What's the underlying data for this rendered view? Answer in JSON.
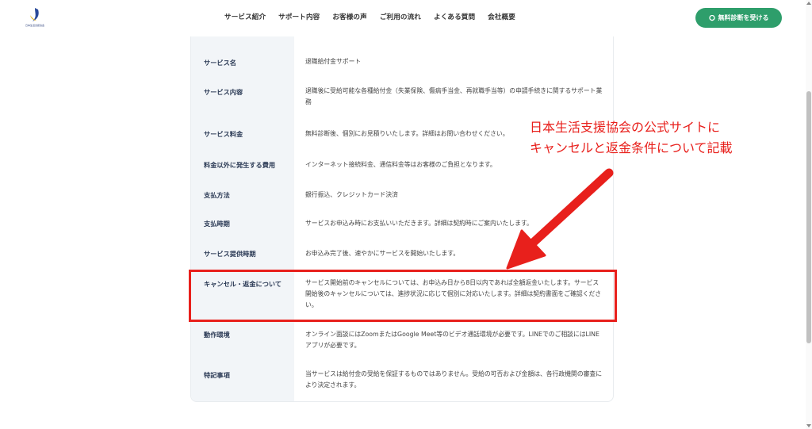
{
  "header": {
    "logo_text": "日本生活支援協会",
    "nav": [
      "サービス紹介",
      "サポート内容",
      "お客様の声",
      "ご利用の流れ",
      "よくある質問",
      "会社概要"
    ],
    "cta_label": "無料診断を受ける"
  },
  "table": {
    "rows": [
      {
        "label": "サービス名",
        "value": "退職給付金サポート"
      },
      {
        "label": "サービス内容",
        "value": "退職後に受給可能な各種給付金（失業保険、傷病手当金、再就職手当等）の申請手続きに関するサポート業務"
      },
      {
        "label": "サービス料金",
        "value": "無料診断後、個別にお見積りいたします。詳細はお問い合わせください。"
      },
      {
        "label": "料金以外に発生する費用",
        "value": "インターネット接続料金、通信料金等はお客様のご負担となります。"
      },
      {
        "label": "支払方法",
        "value": "銀行振込、クレジットカード決済"
      },
      {
        "label": "支払時期",
        "value": "サービスお申込み時にお支払いいただきます。詳細は契約時にご案内いたします。"
      },
      {
        "label": "サービス提供時期",
        "value": "お申込み完了後、速やかにサービスを開始いたします。"
      },
      {
        "label": "キャンセル・返金について",
        "value": "サービス開始前のキャンセルについては、お申込み日から8日以内であれば全額返金いたします。サービス開始後のキャンセルについては、進捗状況に応じて個別に対応いたします。詳細は契約書面をご確認ください。"
      },
      {
        "label": "動作環境",
        "value": "オンライン面談にはZoomまたはGoogle Meet等のビデオ通話環境が必要です。LINEでのご相談にはLINEアプリが必要です。"
      },
      {
        "label": "特記事項",
        "value": "当サービスは給付金の受給を保証するものではありません。受給の可否および金額は、各行政機関の審査により決定されます。"
      }
    ]
  },
  "annotation": {
    "line1": "日本生活支援協会の公式サイトに",
    "line2": "キャンセルと返金条件について記載",
    "color": "#e8201c"
  },
  "colors": {
    "accent": "#2e9e6b",
    "label_bg": "#f2f5f8",
    "label_text": "#2b3a55"
  }
}
